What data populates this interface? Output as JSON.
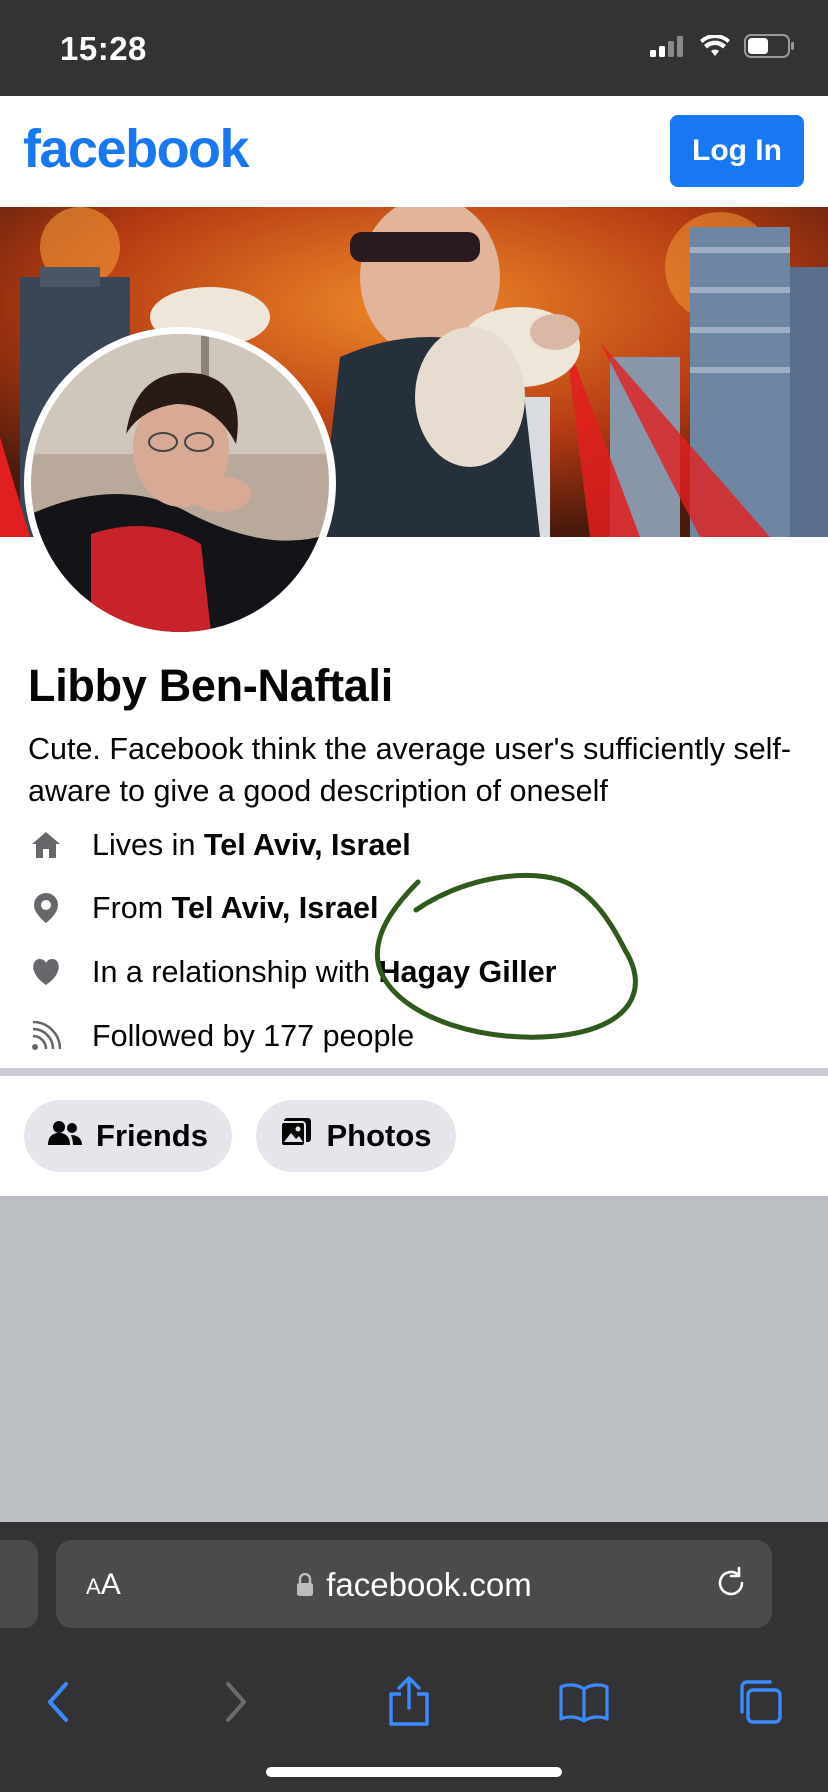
{
  "status": {
    "time": "15:28"
  },
  "header": {
    "logo": "facebook",
    "login_label": "Log In"
  },
  "profile": {
    "name": "Libby Ben-Naftali",
    "bio": "Cute. Facebook think the average user's sufficiently self-aware to give a good description of oneself",
    "info": [
      {
        "icon": "home-icon",
        "prefix": "Lives in ",
        "bold": "Tel Aviv, Israel",
        "suffix": ""
      },
      {
        "icon": "location-pin-icon",
        "prefix": "From ",
        "bold": "Tel Aviv, Israel",
        "suffix": ""
      },
      {
        "icon": "heart-icon",
        "prefix": "In a relationship with ",
        "bold": "Hagay Giller",
        "suffix": ""
      },
      {
        "icon": "rss-icon",
        "prefix": "Followed by 177 people",
        "bold": "",
        "suffix": ""
      }
    ]
  },
  "tabs": [
    {
      "label": "Friends",
      "icon": "friends-icon"
    },
    {
      "label": "Photos",
      "icon": "photos-icon"
    }
  ],
  "browser": {
    "text_size": "AA",
    "url": "facebook.com"
  },
  "colors": {
    "brand": "#1877f2",
    "annotation": "#2f5a1c"
  }
}
